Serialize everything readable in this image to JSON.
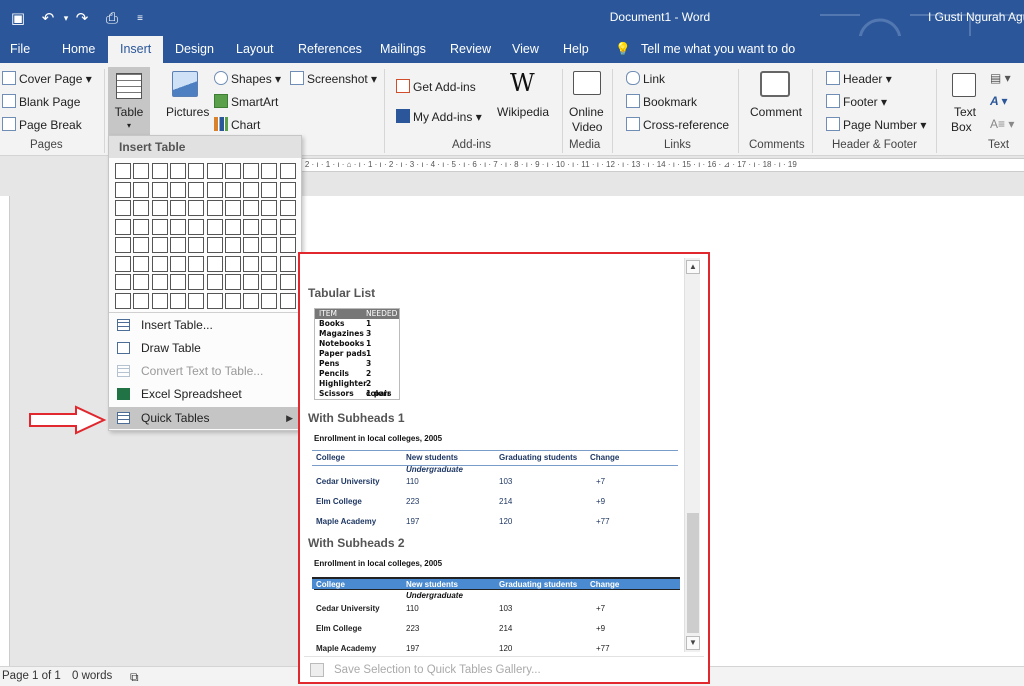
{
  "titlebar": {
    "doc_title": "Document1  -  Word",
    "user": "I Gusti Ngurah Agu"
  },
  "tabs": [
    "File",
    "Home",
    "Insert",
    "Design",
    "Layout",
    "References",
    "Mailings",
    "Review",
    "View",
    "Help"
  ],
  "tell_me": "Tell me what you want to do",
  "ribbon": {
    "pages": {
      "items": [
        "Cover Page",
        "Blank Page",
        "Page Break"
      ],
      "label": "Pages"
    },
    "table": {
      "label": "Table"
    },
    "illustrations": {
      "pictures": "Pictures",
      "shapes": "Shapes",
      "smartart": "SmartArt",
      "chart": "Chart",
      "screenshot": "Screenshot"
    },
    "addins": {
      "get": "Get Add-ins",
      "my": "My Add-ins",
      "wikipedia": "Wikipedia",
      "label": "Add-ins"
    },
    "media": {
      "online_video_1": "Online",
      "online_video_2": "Video",
      "label": "Media"
    },
    "links": {
      "link": "Link",
      "bookmark": "Bookmark",
      "cross": "Cross-reference",
      "label": "Links"
    },
    "comments": {
      "comment": "Comment",
      "label": "Comments"
    },
    "header_footer": {
      "header": "Header",
      "footer": "Footer",
      "page_number": "Page Number",
      "label": "Header & Footer"
    },
    "text": {
      "textbox_1": "Text",
      "textbox_2": "Box",
      "label": "Text"
    }
  },
  "ruler_text": "· 2 · ı · 1 · ı · ⌂ · ı · 1 · ı · 2 · ı · 3 · ı · 4 · ı · 5 · ı · 6 · ı · 7 · ı · 8 · ı · 9 · ı · 10 · ı · 11 · ı · 12 · ı · 13 · ı · 14 · ı · 15 · ı · 16 · ⊿ · 17 · ı · 18 · ı · 19",
  "insert_table_menu": {
    "title": "Insert Table",
    "items": [
      {
        "label": "Insert Table...",
        "disabled": false
      },
      {
        "label": "Draw Table",
        "disabled": false
      },
      {
        "label": "Convert Text to Table...",
        "disabled": true
      },
      {
        "label": "Excel Spreadsheet",
        "disabled": false
      },
      {
        "label": "Quick Tables",
        "disabled": false
      }
    ]
  },
  "quick_tables": {
    "tabular_list": {
      "title": "Tabular List",
      "header": [
        "ITEM",
        "NEEDED"
      ],
      "rows": [
        [
          "Books",
          "1"
        ],
        [
          "Magazines",
          "3"
        ],
        [
          "Notebooks",
          "1"
        ],
        [
          "Paper pads",
          "1"
        ],
        [
          "Pens",
          "3"
        ],
        [
          "Pencils",
          "2"
        ],
        [
          "Highlighter",
          "2 colors"
        ],
        [
          "Scissors",
          "1 pair"
        ]
      ]
    },
    "subheads1": {
      "title": "With Subheads 1",
      "caption": "Enrollment in local colleges, 2005",
      "header": [
        "College",
        "New students",
        "Graduating students",
        "Change"
      ],
      "subhead": "Undergraduate",
      "rows": [
        [
          "Cedar University",
          "110",
          "103",
          "+7"
        ],
        [
          "Elm College",
          "223",
          "214",
          "+9"
        ],
        [
          "Maple Academy",
          "197",
          "120",
          "+77"
        ]
      ]
    },
    "subheads2": {
      "title": "With Subheads 2",
      "caption": "Enrollment in local colleges, 2005",
      "header": [
        "College",
        "New students",
        "Graduating students",
        "Change"
      ],
      "subhead": "Undergraduate",
      "rows": [
        [
          "Cedar University",
          "110",
          "103",
          "+7"
        ],
        [
          "Elm College",
          "223",
          "214",
          "+9"
        ],
        [
          "Maple Academy",
          "197",
          "120",
          "+77"
        ]
      ]
    },
    "footer": "Save Selection to Quick Tables Gallery..."
  },
  "status": {
    "page": "Page 1 of 1",
    "words": "0 words"
  }
}
